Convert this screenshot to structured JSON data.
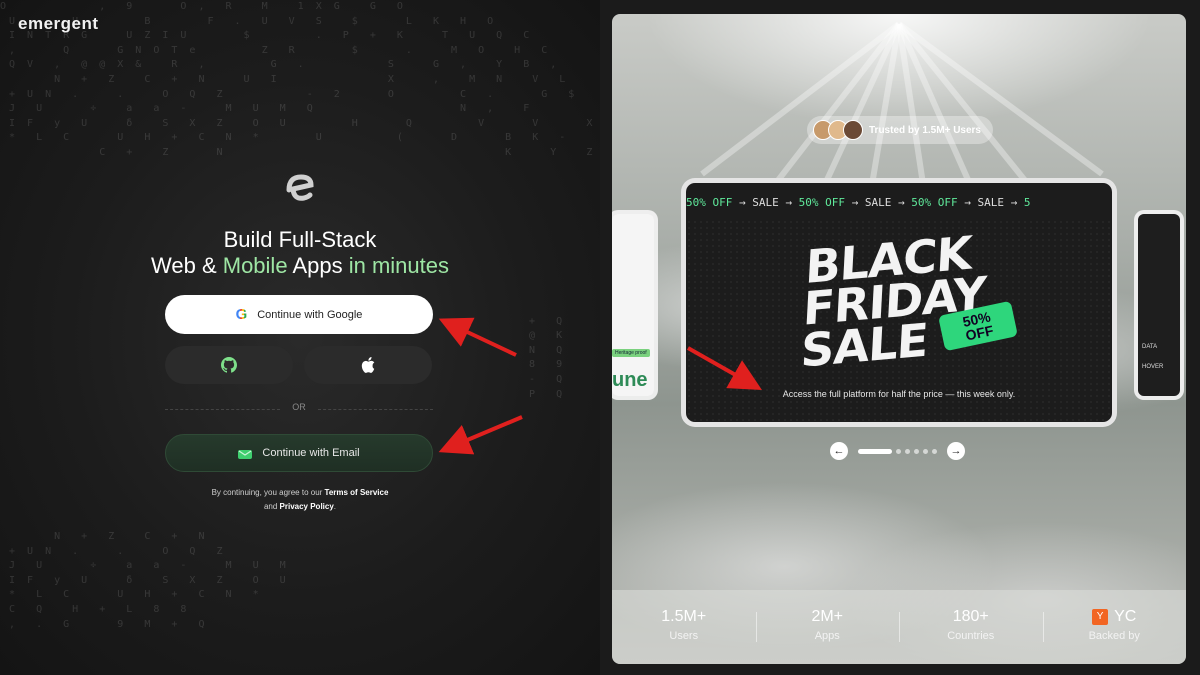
{
  "brand": {
    "name": "emergent"
  },
  "headline": {
    "line1": "Build Full-Stack",
    "line2_a": "Web & ",
    "line2_b": "Mobile",
    "line2_c": " Apps",
    "line2_d": " in minutes"
  },
  "auth": {
    "google_label": "Continue with Google",
    "or_label": "OR",
    "email_label": "Continue with Email",
    "terms_prefix": "By continuing, you agree to our ",
    "terms_link": "Terms of Service",
    "terms_and": "and ",
    "privacy_link": "Privacy Policy",
    "terms_suffix": "."
  },
  "promo": {
    "trusted_label": "Trusted by 1.5M+ Users",
    "ticker": [
      {
        "text": "50% OFF",
        "kind": "off"
      },
      {
        "text": "→",
        "kind": "arrow"
      },
      {
        "text": "SALE",
        "kind": "sale"
      },
      {
        "text": "→",
        "kind": "arrow"
      },
      {
        "text": "50% OFF",
        "kind": "off"
      },
      {
        "text": "→",
        "kind": "arrow"
      },
      {
        "text": "SALE",
        "kind": "sale"
      },
      {
        "text": "→",
        "kind": "arrow"
      },
      {
        "text": "50% OFF",
        "kind": "off"
      },
      {
        "text": "→",
        "kind": "arrow"
      },
      {
        "text": "SALE",
        "kind": "sale"
      },
      {
        "text": "→",
        "kind": "arrow"
      },
      {
        "text": "5",
        "kind": "off"
      }
    ],
    "title_line1": "BLACK",
    "title_line2": "FRIDAY",
    "title_line3": "SALE",
    "tag_line1": "50%",
    "tag_line2": "OFF",
    "description": "Access the full platform for half the price — this week only.",
    "side_left_tag": "Heritage proof",
    "side_left_text": "une",
    "side_right_text1": "DATA",
    "side_right_text2": "HOVER",
    "prev_icon": "arrow-left-icon",
    "next_icon": "arrow-right-icon",
    "active_slide": 1,
    "total_slides": 6
  },
  "stats": [
    {
      "value": "1.5M+",
      "label": "Users"
    },
    {
      "value": "2M+",
      "label": "Apps"
    },
    {
      "value": "180+",
      "label": "Countries"
    },
    {
      "value": "YC",
      "label": "Backed by",
      "badge": "Y"
    }
  ],
  "colors": {
    "accent_green": "#9ee6a4",
    "off_green": "#5fe89a",
    "tag_green": "#2ed67c",
    "yc_orange": "#f26522",
    "arrow_red": "#e0201e"
  }
}
